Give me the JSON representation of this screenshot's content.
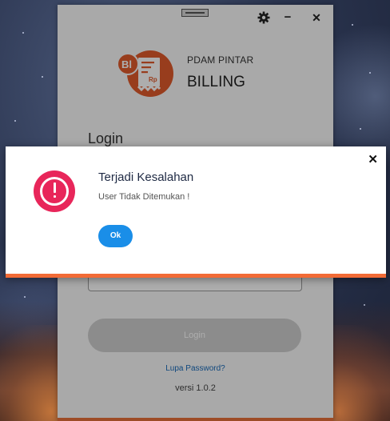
{
  "window": {
    "brand_subtitle": "PDAM PINTAR",
    "brand_title": "BILLING",
    "login_heading": "Login",
    "login_button": "Login",
    "forgot_password": "Lupa Password?",
    "version": "versi 1.0.2",
    "controls": {
      "settings_icon": "gear-icon",
      "minimize_label": "−",
      "close_label": "✕"
    }
  },
  "logo": {
    "badge_text": "Bl",
    "currency_text": "Rp"
  },
  "dialog": {
    "title": "Terjadi Kesalahan",
    "message": "User Tidak Ditemukan !",
    "ok_label": "Ok",
    "close_label": "✕",
    "icon": "error-icon"
  },
  "colors": {
    "accent_orange": "#f26b36",
    "error_pink": "#e8265a",
    "ok_blue": "#1a8ee8",
    "brand_orange": "#e05a2c"
  }
}
